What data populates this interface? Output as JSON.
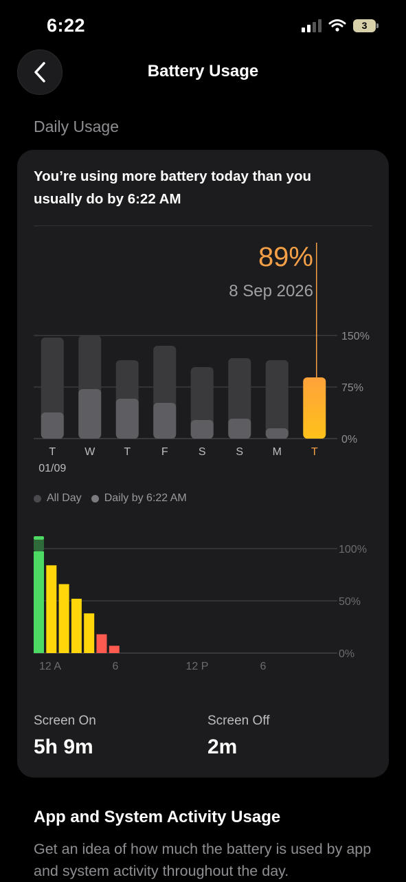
{
  "status_bar": {
    "time": "6:22",
    "battery_level": "3"
  },
  "nav": {
    "title": "Battery Usage"
  },
  "daily": {
    "section_label": "Daily Usage",
    "headline": "You’re using more battery today than you usually do by 6:22 AM",
    "highlight_percent": "89%",
    "highlight_date": "8 Sep 2026",
    "legend": {
      "all_day": "All Day",
      "daily_by": "Daily by 6:22 AM"
    }
  },
  "stats": {
    "screen_on_label": "Screen On",
    "screen_on_value": "5h 9m",
    "screen_off_label": "Screen Off",
    "screen_off_value": "2m"
  },
  "activity": {
    "title": "App and System Activity Usage",
    "description": "Get an idea of how much the battery is used by app and system activity throughout the day."
  },
  "colors": {
    "accent": "#f5a046",
    "green": "#4cd964",
    "yellow": "#ffd60a",
    "red": "#ff5a4f"
  },
  "chart_data": [
    {
      "type": "bar",
      "categories": [
        "T",
        "W",
        "T",
        "F",
        "S",
        "S",
        "M",
        "T"
      ],
      "sub_labels": [
        "01/09",
        "",
        "",
        "",
        "",
        "",
        "",
        ""
      ],
      "series": [
        {
          "name": "All Day",
          "values": [
            147,
            150,
            114,
            135,
            104,
            117,
            114,
            89
          ]
        },
        {
          "name": "Daily by 6:22 AM",
          "values": [
            38,
            72,
            58,
            52,
            27,
            29,
            15,
            89
          ]
        }
      ],
      "highlight_index": 7,
      "y_ticks": [
        "0%",
        "75%",
        "150%"
      ],
      "ylim": [
        0,
        150
      ],
      "grid": true
    },
    {
      "type": "bar",
      "categories": [
        "12 A",
        "6",
        "12 P",
        "6"
      ],
      "values": [
        100,
        84,
        66,
        52,
        38,
        18,
        7
      ],
      "charging_peak": 100,
      "y_ticks": [
        "0%",
        "50%",
        "100%"
      ],
      "ylim": [
        0,
        100
      ],
      "grid": true
    }
  ]
}
